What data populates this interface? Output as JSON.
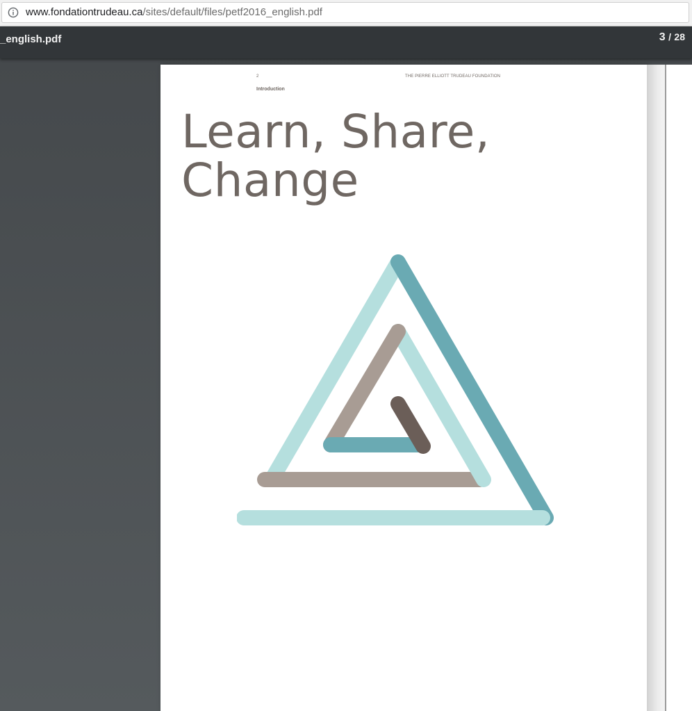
{
  "browser": {
    "url_host": "www.fondationtrudeau.ca",
    "url_path": "/sites/default/files/petf2016_english.pdf",
    "info_icon": "info-circle-icon"
  },
  "toolbar": {
    "title": "_english.pdf",
    "current_page": "3",
    "separator": "/",
    "total_pages": "28"
  },
  "page": {
    "page_number": "2",
    "running_header": "THE PIERRE ELLIOTT TRUDEAU FOUNDATION",
    "section": "Introduction",
    "headline_line1": "Learn, Share,",
    "headline_line2": "Change",
    "logo": "spiral-triangle-logo"
  },
  "colors": {
    "light_teal": "#b5dfde",
    "dark_teal": "#6aaab3",
    "taupe": "#a89c94",
    "dark_brown": "#6b5e58",
    "headline_text": "#6f6762",
    "toolbar_bg": "#323639",
    "viewer_bg": "#525659"
  }
}
